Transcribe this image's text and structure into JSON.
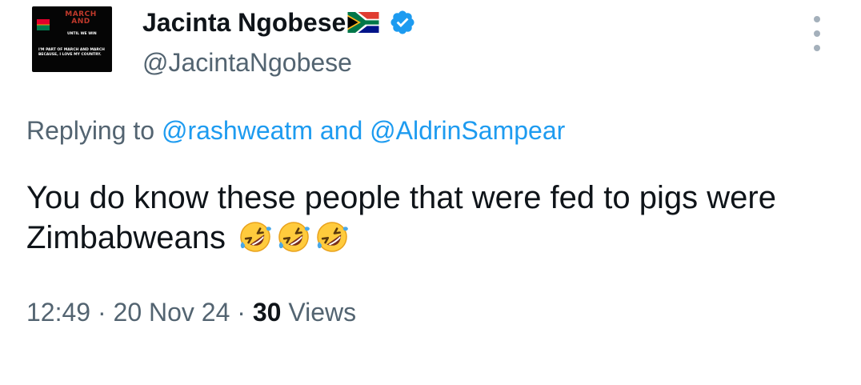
{
  "author": {
    "display_name": "Jacinta Ngobese",
    "handle": "@JacintaNgobese",
    "flag_icon": "south-africa-flag-icon",
    "verified_icon": "verified-badge-icon",
    "verified_color": "#1d9bf0",
    "avatar": {
      "title_line1": "MARCH",
      "title_line2": "AND",
      "subtitle": "UNTIL WE WIN",
      "caption_line1": "I'M PART OF MARCH AND MARCH",
      "caption_line2": "BECAUSE, I LOVE MY COUNTRY."
    }
  },
  "menu": {
    "icon": "more-vertical-icon"
  },
  "reply": {
    "prefix": "Replying to",
    "user1": "@rashweatm",
    "connector": "and",
    "user2": "@AldrinSampear"
  },
  "tweet": {
    "text": "You do know these people that were fed to pigs were Zimbabweans",
    "emojis": [
      "rolling-on-floor-laughing-emoji",
      "rolling-on-floor-laughing-emoji",
      "rolling-on-floor-laughing-emoji"
    ]
  },
  "meta": {
    "time": "12:49",
    "separator": "·",
    "date": "20 Nov 24",
    "views_count": "30",
    "views_label": "Views"
  },
  "colors": {
    "text": "#0f1419",
    "secondary": "#536471",
    "link": "#1d9bf0"
  }
}
